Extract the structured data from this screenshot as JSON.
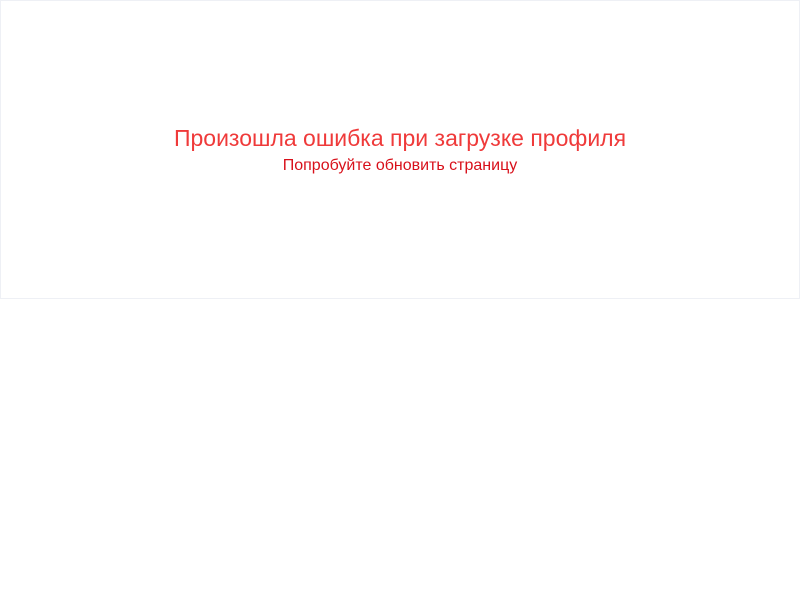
{
  "error": {
    "title": "Произошла ошибка при загрузке профиля",
    "hint": "Попробуйте обновить страницу"
  },
  "colors": {
    "title": "#ef3a3a",
    "hint": "#d8101a",
    "panel_border": "#eef0f5",
    "background": "#ffffff"
  }
}
